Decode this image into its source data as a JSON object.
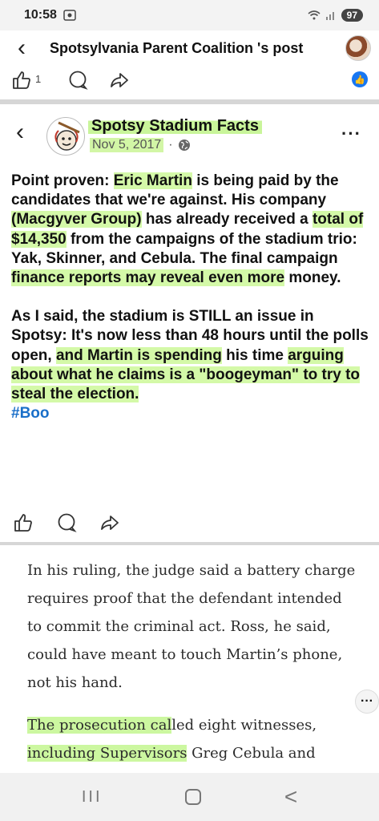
{
  "status_bar": {
    "time": "10:58",
    "battery": "97"
  },
  "header": {
    "title": "Spotsylvania Parent Coalition 's post"
  },
  "reactions": {
    "count": "1"
  },
  "shared_post": {
    "page_name": "Spotsy Stadium Facts",
    "date": "Nov 5, 2017",
    "separator": "·",
    "more": "···",
    "paragraph1": [
      {
        "t": "Point proven: ",
        "h": false
      },
      {
        "t": "Eric Martin",
        "h": true
      },
      {
        "t": " is being paid by the candidates that we're against. His company ",
        "h": false
      },
      {
        "t": "(Macgyver Group)",
        "h": true
      },
      {
        "t": " has already received a ",
        "h": false
      },
      {
        "t": "total of $14,350",
        "h": true
      },
      {
        "t": " from the campaigns of the stadium trio: Yak, Skinner, and Cebula. The final campaign ",
        "h": false
      },
      {
        "t": "finance reports may reveal even more",
        "h": true
      },
      {
        "t": " money.",
        "h": false
      }
    ],
    "paragraph2": [
      {
        "t": "As I said, the stadium is STILL an issue in Spotsy: It's now less than 48 hours until the polls open, ",
        "h": false
      },
      {
        "t": "and Martin is spending",
        "h": true
      },
      {
        "t": " his time ",
        "h": false
      },
      {
        "t": "arguing about what he claims is a \"boogeyman\" to try to steal the election.",
        "h": true
      }
    ],
    "hashtag": "#Boo"
  },
  "article": {
    "paragraph1": "In his ruling, the judge said a battery charge requires proof that the defendant intended to commit the criminal act. Ross, he said, could have meant to touch Martin’s phone, not his hand.",
    "paragraph2_parts": [
      {
        "t": "The prosecution cal",
        "h": true
      },
      {
        "t": "led eight witnesses, ",
        "h": false
      },
      {
        "t": "including Supervisors",
        "h": true
      },
      {
        "t": " Greg Cebula and",
        "h": false
      }
    ],
    "side_more": "···"
  },
  "nav": {
    "recents": "III",
    "back": "<"
  }
}
